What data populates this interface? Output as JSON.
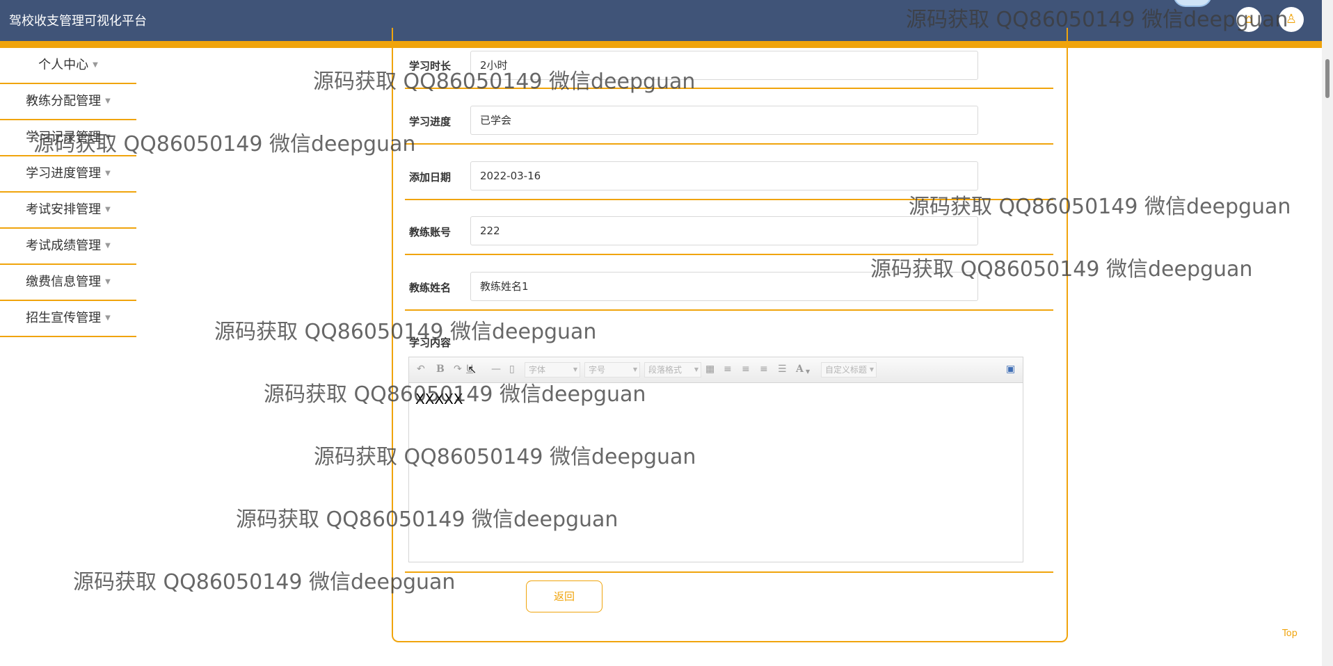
{
  "header": {
    "title": "驾校收支管理可视化平台",
    "icons": {
      "home": "home-icon",
      "user": "user-icon"
    },
    "accent_color": "#f0a40c",
    "bar_color": "#405478"
  },
  "sidebar": {
    "items": [
      {
        "label": "个人中心"
      },
      {
        "label": "教练分配管理"
      },
      {
        "label": "学习记录管理"
      },
      {
        "label": "学习进度管理"
      },
      {
        "label": "考试安排管理"
      },
      {
        "label": "考试成绩管理"
      },
      {
        "label": "缴费信息管理"
      },
      {
        "label": "招生宣传管理"
      }
    ]
  },
  "form": {
    "fields": [
      {
        "label": "学习时长",
        "value": "2小时"
      },
      {
        "label": "学习进度",
        "value": "已学会"
      },
      {
        "label": "添加日期",
        "value": "2022-03-16"
      },
      {
        "label": "教练账号",
        "value": "222"
      },
      {
        "label": "教练姓名",
        "value": "教练姓名1"
      }
    ],
    "content_label": "学习内容",
    "editor": {
      "toolbar": {
        "bold": "B",
        "font_color": "A",
        "font_family_placeholder": "字体",
        "font_size_placeholder": "字号",
        "paragraph_placeholder": "段落格式",
        "custom_title_placeholder": "自定义标题"
      },
      "content": "XXXXX"
    },
    "back_label": "返回"
  },
  "top_link": "Top",
  "watermark_text": "源码获取 QQ86050149 微信deepguan"
}
